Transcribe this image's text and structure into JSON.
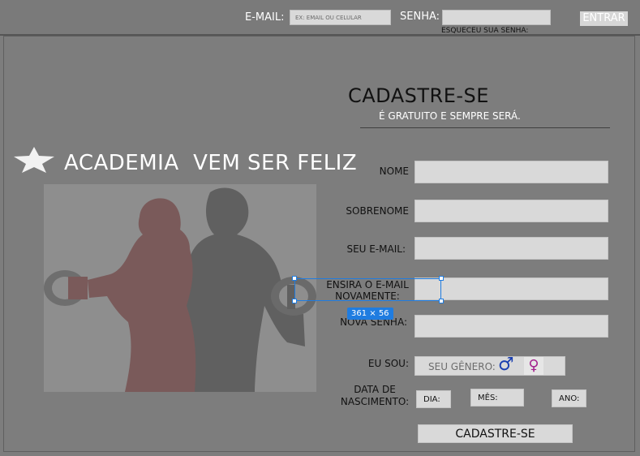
{
  "header": {
    "email_label": "E-MAIL:",
    "email_placeholder": "EX: EMAIL OU CELULAR",
    "password_label": "SENHA:",
    "forgot_label": "ESQUECEU SUA SENHA:",
    "login_button": "ENTRAR"
  },
  "brand": {
    "name": "ACADEMIA  VEM SER FELIZ"
  },
  "signup": {
    "title": "CADASTRE-SE",
    "subtitle": "É GRATUITO E SEMPRE SERÁ.",
    "fields": {
      "first_name": "NOME",
      "last_name": "SOBRENOME",
      "email": "SEU E-MAIL:",
      "email_confirm": "ENSIRA O E-MAIL NOVAMENTE:",
      "password": "NOVA SENHA:",
      "gender": "EU SOU:",
      "birth_date": "DATA DE NASCIMENTO:"
    },
    "gender_placeholder": "SEU GÊNERO:",
    "male_symbol": "♂",
    "female_symbol": "♀",
    "day": "DIA:",
    "month": "MÊS:",
    "year": "ANO:",
    "submit": "CADASTRE-SE"
  },
  "selection": {
    "size_badge": "361 × 56"
  },
  "colors": {
    "background": "#7d7d7d",
    "field": "#d9d9d9",
    "selection": "#1f7ce0",
    "male": "#1a3fb0",
    "female": "#a3208e"
  }
}
